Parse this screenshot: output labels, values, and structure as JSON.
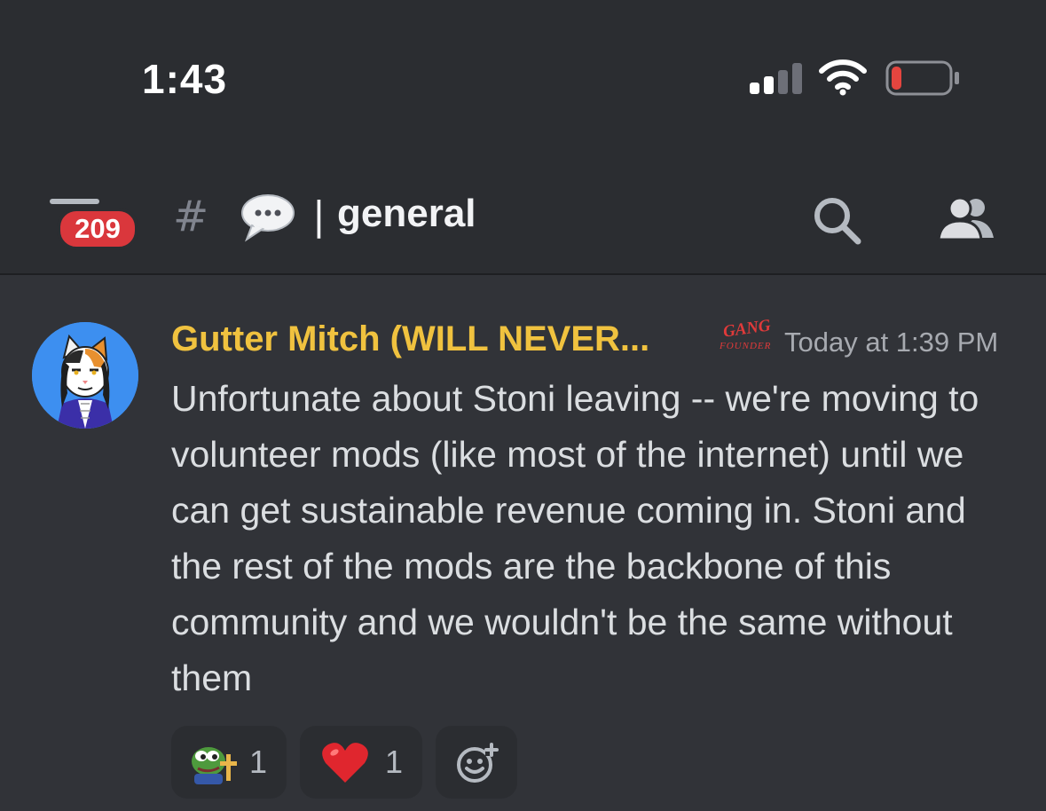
{
  "status_bar": {
    "time": "1:43",
    "battery_color": "#e5453f",
    "icons": [
      "cellular-signal-icon",
      "wifi-icon",
      "battery-low-icon"
    ]
  },
  "header": {
    "unread_count": "209",
    "channel_prefix": "#",
    "separator": "|",
    "channel_name": "general",
    "icons": [
      "menu-icon",
      "hash-icon",
      "speech-bubble-emoji",
      "search-icon",
      "members-icon"
    ]
  },
  "message": {
    "author": "Gutter Mitch (WILL NEVER...",
    "author_color": "#f0c23f",
    "role_tag": {
      "line1": "GANG",
      "line2": "FOUNDER"
    },
    "timestamp": "Today at 1:39 PM",
    "text": "Unfortunate about Stoni leaving -- we're moving to volunteer mods (like most of the internet) until we can get sustainable revenue coming in. Stoni and the rest of the mods are the backbone of this community and we wouldn't be the same without them",
    "reactions": [
      {
        "emoji": "pepe-cross-emoji",
        "count": "1"
      },
      {
        "emoji": "red-heart-emoji",
        "count": "1"
      }
    ],
    "add_reaction_icon": "add-reaction-icon"
  }
}
